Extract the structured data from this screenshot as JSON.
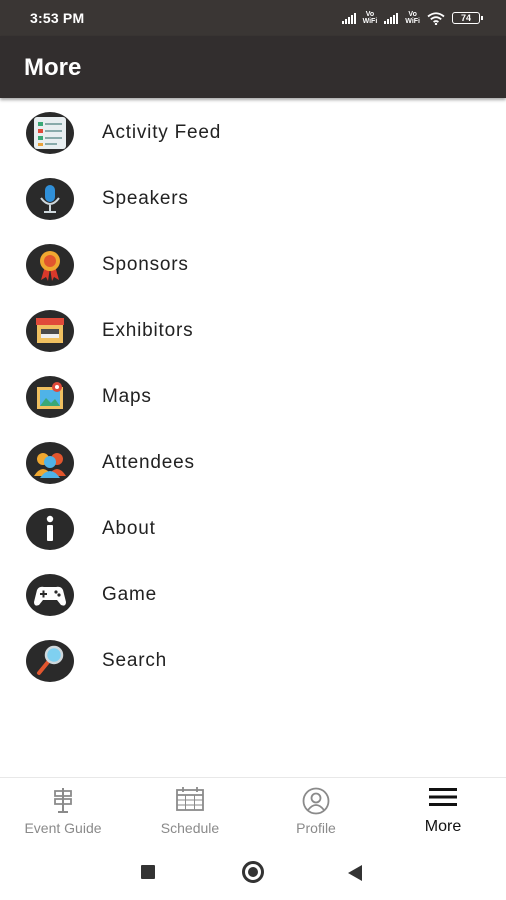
{
  "status_bar": {
    "time": "3:53 PM",
    "vowifi_label": "Vo\nWiFi",
    "battery": "74"
  },
  "app_bar": {
    "title": "More"
  },
  "menu": {
    "items": [
      {
        "label": "Activity Feed",
        "icon": "activity-feed-icon"
      },
      {
        "label": "Speakers",
        "icon": "microphone-icon"
      },
      {
        "label": "Sponsors",
        "icon": "ribbon-badge-icon"
      },
      {
        "label": "Exhibitors",
        "icon": "storefront-icon"
      },
      {
        "label": "Maps",
        "icon": "map-pin-icon"
      },
      {
        "label": "Attendees",
        "icon": "people-icon"
      },
      {
        "label": "About",
        "icon": "info-icon"
      },
      {
        "label": "Game",
        "icon": "gamepad-icon"
      },
      {
        "label": "Search",
        "icon": "magnifier-icon"
      }
    ]
  },
  "bottom_nav": {
    "tabs": [
      {
        "label": "Event Guide",
        "icon": "signpost-icon",
        "active": false
      },
      {
        "label": "Schedule",
        "icon": "calendar-icon",
        "active": false
      },
      {
        "label": "Profile",
        "icon": "user-circle-icon",
        "active": false
      },
      {
        "label": "More",
        "icon": "hamburger-icon",
        "active": true
      }
    ]
  },
  "colors": {
    "status_bar_bg": "#3a3634",
    "app_bar_bg": "#322e2e",
    "active_tab_text": "#111111",
    "inactive_tab_text": "#8a8a8a"
  }
}
